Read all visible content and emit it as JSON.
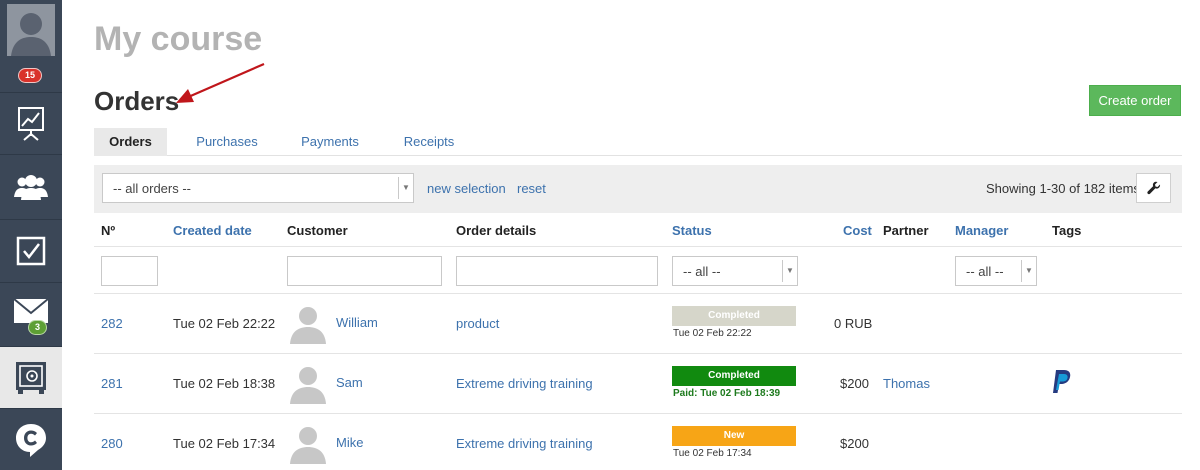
{
  "sidebar": {
    "notifications_badge": "15",
    "mail_badge": "3",
    "items": [
      {
        "icon": "analytics-icon"
      },
      {
        "icon": "users-icon"
      },
      {
        "icon": "tasks-icon"
      },
      {
        "icon": "mail-icon"
      },
      {
        "icon": "safe-icon"
      },
      {
        "icon": "chat-logo-icon"
      }
    ]
  },
  "header": {
    "page_title": "My course",
    "section_title": "Orders",
    "create_button": "Create order"
  },
  "tabs": [
    {
      "label": "Orders",
      "active": true
    },
    {
      "label": "Purchases"
    },
    {
      "label": "Payments"
    },
    {
      "label": "Receipts"
    }
  ],
  "filter": {
    "select_value": "-- all orders --",
    "new_selection": "new selection",
    "reset": "reset",
    "count_text": "Showing 1-30 of 182 items."
  },
  "table": {
    "columns": {
      "number": "Nº",
      "created": "Created date",
      "customer": "Customer",
      "details": "Order details",
      "status": "Status",
      "cost": "Cost",
      "partner": "Partner",
      "manager": "Manager",
      "tags": "Tags"
    },
    "status_filter": "-- all --",
    "manager_filter": "-- all --",
    "rows": [
      {
        "number": "282",
        "created": "Tue 02 Feb 22:22",
        "customer": "William",
        "details": "product",
        "status": "Completed",
        "status_color": "#d6d6ca",
        "status_sub": "Tue 02 Feb 22:22",
        "cost": "0 RUB",
        "partner": "",
        "tag_icon": ""
      },
      {
        "number": "281",
        "created": "Tue 02 Feb 18:38",
        "customer": "Sam",
        "details": "Extreme driving training",
        "status": "Completed",
        "status_color": "#118a0f",
        "status_sub": "Paid: Tue 02 Feb 18:39",
        "cost": "$200",
        "partner": "Thomas",
        "tag_icon": "paypal-icon"
      },
      {
        "number": "280",
        "created": "Tue 02 Feb 17:34",
        "customer": "Mike",
        "details": "Extreme driving training",
        "status": "New",
        "status_color": "#f7a516",
        "status_sub": "Tue 02 Feb 17:34",
        "cost": "$200",
        "partner": "",
        "tag_icon": ""
      }
    ]
  },
  "colors": {
    "sidebar_bg": "#3b4757",
    "link": "#3d72ad",
    "primary_button": "#5cb85c"
  }
}
